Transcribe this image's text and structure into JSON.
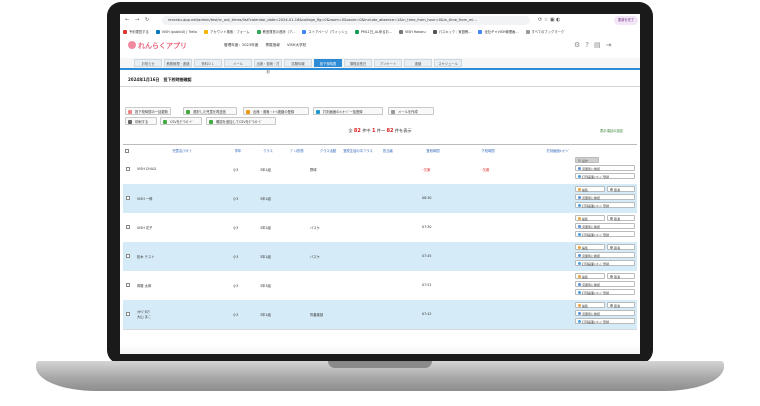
{
  "browser": {
    "url": "renraku-app.net/admin/test/rc_out_times/list?calendar_date=2024-01-16&college_flg=0&room=0&room=0&include_absence=1&in_time_from_hour=0&in_time_from_mi...",
    "profile_label": "更新を完了",
    "bookmarks": [
      {
        "label": "予約運営する",
        "color": "#d33"
      },
      {
        "label": "VISH (public0) | Trello",
        "color": "#0079bf"
      },
      {
        "label": "アカウント検索｜フォーム",
        "color": "#f4b400"
      },
      {
        "label": "教室運営の進捗（ア...",
        "color": "#34a853"
      },
      {
        "label": "ストアページ（ウィッシュ",
        "color": "#4285f4"
      },
      {
        "label": "PM11日_AL伊るお...",
        "color": "#0f9d58"
      },
      {
        "label": "VISH Hakaru",
        "color": "#777"
      },
      {
        "label": "パスキック｜家庭教...",
        "color": "#555"
      },
      {
        "label": "全社ギャVISH管理画...",
        "color": "#4285f4"
      },
      {
        "label": "すべてのブックマーク",
        "color": "#999"
      }
    ]
  },
  "header": {
    "app_name": "れんらくアプリ",
    "year_label": "管理年度：2023年度",
    "site_label": "専属指導",
    "school_label": "VISH大学校"
  },
  "tabs": [
    "お知らせ",
    "教務管理・連絡",
    "資料ＤＬ",
    "メール",
    "出席・退席・打刻",
    "試験情報",
    "投下校時間",
    "課程延長日",
    "アンケート",
    "連絡",
    "スケジュール"
  ],
  "active_tab": 6,
  "page": {
    "title": "2024年1月16日　投下校時間確認",
    "buttons": [
      "投下校時間の一括更新",
      "選択した児童を再送信",
      "出席・退席・ﾒｰﾙ連絡の登録",
      "打刻画面のﾒｯｾｰｼﾞ一括登録",
      "メールを作成",
      "印刷する",
      "CSVをﾀﾞｳﾝﾛｰﾄﾞ",
      "確認を追加してCSVをﾀﾞｳﾝﾛｰﾄﾞ"
    ],
    "count_prefix": "全",
    "count_total": "82",
    "count_mid1": "件中",
    "count_from": "1",
    "count_mid2": "件～",
    "count_to": "82",
    "count_suffix": "件を表示",
    "settings_link": "表示項目の設定"
  },
  "table": {
    "headers": [
      "児童名/ﾌﾘｶﾞﾅ",
      "学年",
      "クラス",
      "ﾃﾞｨｽ形態",
      "クラス活動",
      "登校生徒の中フラス",
      "担当者",
      "登校時間",
      "下校時間",
      "打刻画面ﾒｯｾｰｼﾞ"
    ],
    "rows": [
      {
        "name": "VISH CHILD",
        "name2": "",
        "grade": "小3",
        "class": "3年1組",
        "activity": "野球",
        "in": "ｰ欠席",
        "out": "ｰ欠席",
        "red": true
      },
      {
        "name": "VISH 一郎",
        "name2": "",
        "grade": "小3",
        "class": "3年1組",
        "activity": "",
        "in": "08:30",
        "out": "",
        "red": false
      },
      {
        "name": "VISH 花子",
        "name2": "",
        "grade": "小3",
        "class": "3年2組",
        "activity": "バスケ",
        "in": "07:30",
        "out": "",
        "red": false
      },
      {
        "name": "松木 テスト",
        "name2": "",
        "grade": "小3",
        "class": "3年1組",
        "activity": "バスケ",
        "in": "07:45",
        "out": "",
        "red": false
      },
      {
        "name": "斉藤 太郎",
        "name2": "",
        "grade": "小3",
        "class": "3年3組",
        "activity": "",
        "in": "07:52",
        "out": "",
        "red": false
      },
      {
        "name": "ｵｵﾔﾏ ﾀﾛｳ",
        "name2": "大山 まこ",
        "grade": "小3",
        "class": "3年1組",
        "activity": "吹奏楽部",
        "in": "07:42",
        "out": "",
        "red": false
      }
    ],
    "actions": {
      "disabled": "操作",
      "edit": "編集",
      "cancel": "取消",
      "status": "児童別に確認",
      "message": "打刻画面ﾒｯｾｰｼﾞ登録"
    }
  },
  "colors": {
    "accent": "#2e8bd6",
    "row_blue": "#d6ebf8",
    "logo": "#e8627a",
    "absent": "#d22"
  }
}
